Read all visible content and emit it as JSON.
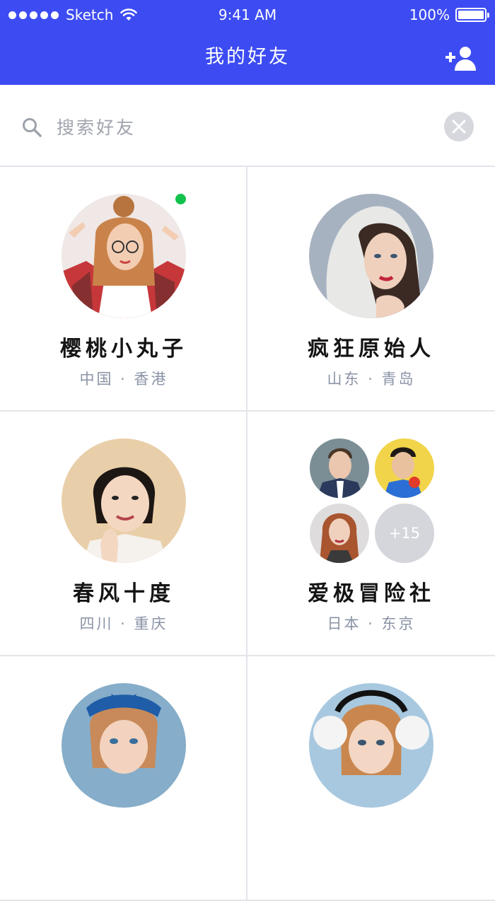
{
  "status_bar": {
    "carrier": "Sketch",
    "time": "9:41 AM",
    "battery": "100%"
  },
  "header": {
    "title": "我的好友",
    "add_icon": "add-user-icon"
  },
  "search": {
    "placeholder": "搜索好友",
    "value": "",
    "search_icon": "search-icon",
    "clear_icon": "close-icon"
  },
  "friends": [
    {
      "name": "樱桃小丸子",
      "location": "中国 · 香港",
      "online": true
    },
    {
      "name": "疯狂原始人",
      "location": "山东 · 青岛",
      "online": false
    },
    {
      "name": "春风十度",
      "location": "四川 · 重庆",
      "online": false
    },
    {
      "name": "爱极冒险社",
      "location": "日本 · 东京",
      "online": false,
      "group": true,
      "more_count": "+15"
    },
    {
      "name": "",
      "location": ""
    },
    {
      "name": "",
      "location": ""
    }
  ],
  "colors": {
    "header_bg": "#3d4cf2",
    "online": "#13c24c",
    "location_text": "#8a93a6"
  }
}
